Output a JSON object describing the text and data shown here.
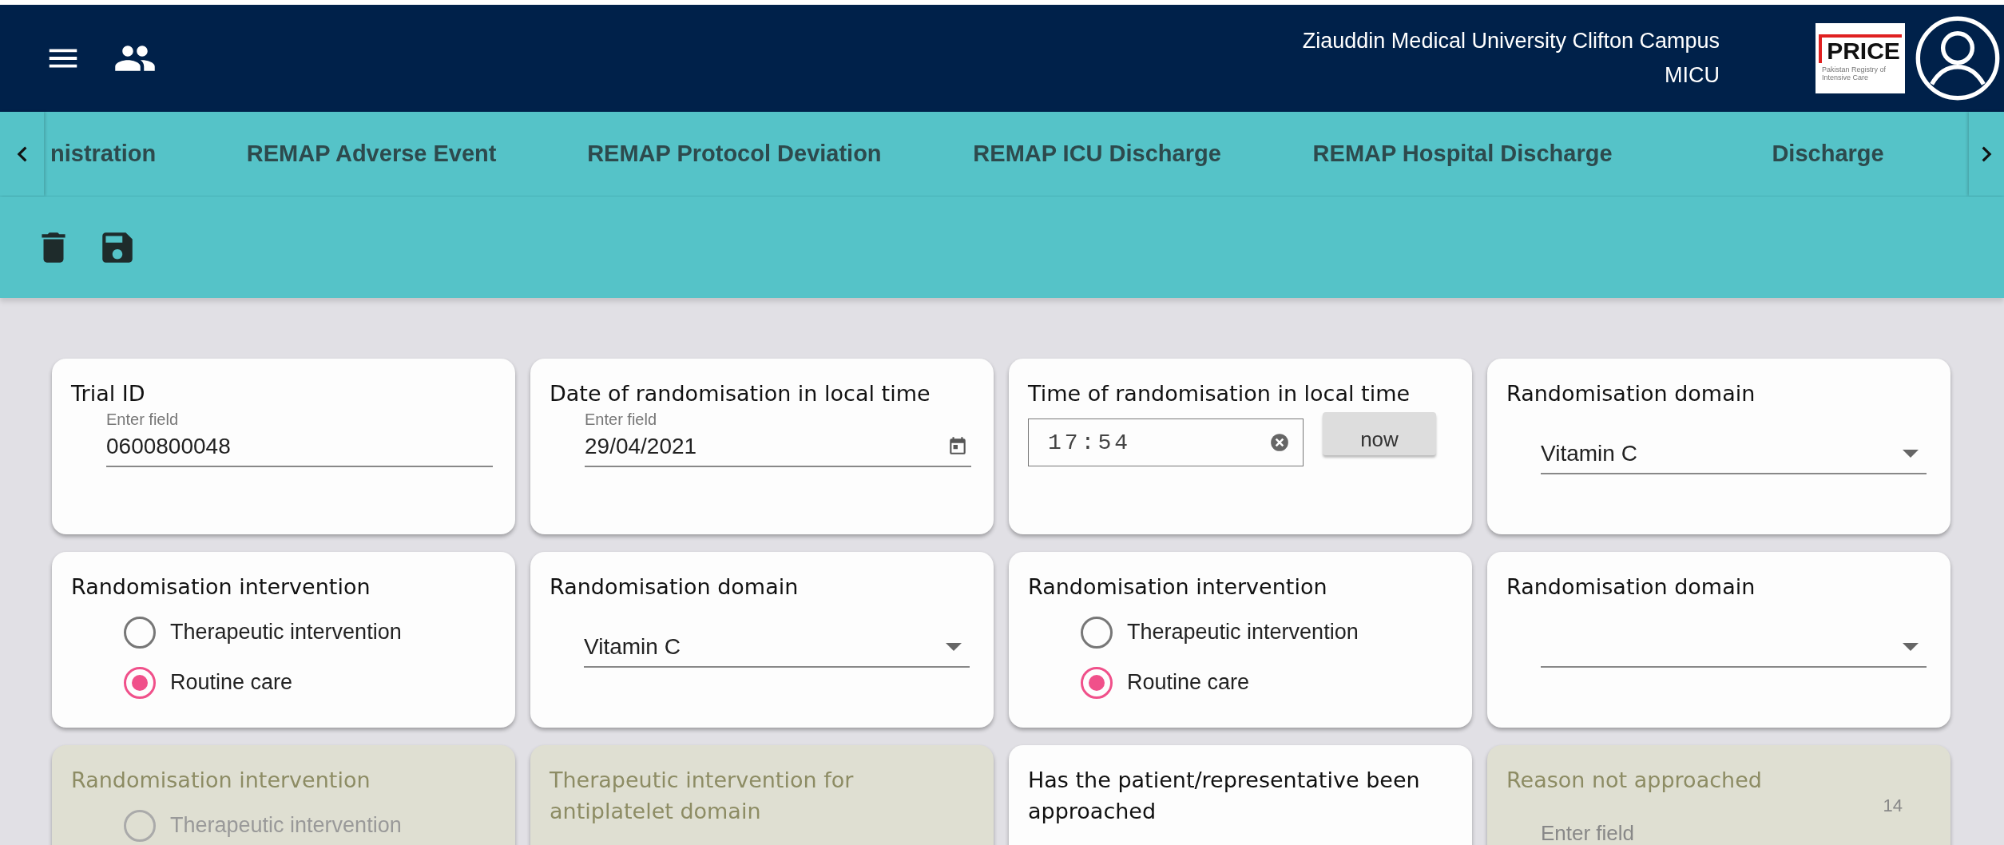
{
  "header": {
    "title": "Ziauddin Medical University Clifton Campus",
    "subtitle": "MICU",
    "logo_text": "PRICE",
    "logo_caption": "Pakistan Registry of Intensive Care"
  },
  "tabs": [
    {
      "label": "nistration",
      "selected": false
    },
    {
      "label": "REMAP Adverse Event",
      "selected": false
    },
    {
      "label": "REMAP Protocol Deviation",
      "selected": false
    },
    {
      "label": "REMAP ICU Discharge",
      "selected": false
    },
    {
      "label": "REMAP Hospital Discharge",
      "selected": false
    },
    {
      "label": "Discharge",
      "selected": false
    }
  ],
  "cards": [
    {
      "kind": "text",
      "label": "Trial ID",
      "disabled": false,
      "field_label": "Enter field",
      "value": "0600800048"
    },
    {
      "kind": "date",
      "label": "Date of randomisation in local time",
      "disabled": false,
      "field_label": "Enter field",
      "value": "29/04/2021"
    },
    {
      "kind": "time",
      "label": "Time of randomisation in local time",
      "disabled": false,
      "value": "17:54",
      "button": "now"
    },
    {
      "kind": "select",
      "label": "Randomisation domain",
      "disabled": false,
      "value": "Vitamin C"
    },
    {
      "kind": "radio",
      "label": "Randomisation intervention",
      "disabled": false,
      "options": [
        {
          "label": "Therapeutic intervention",
          "selected": false
        },
        {
          "label": "Routine care",
          "selected": true
        }
      ]
    },
    {
      "kind": "select",
      "label": "Randomisation domain",
      "disabled": false,
      "value": "Vitamin C"
    },
    {
      "kind": "radio",
      "label": "Randomisation intervention",
      "disabled": false,
      "options": [
        {
          "label": "Therapeutic intervention",
          "selected": false
        },
        {
          "label": "Routine care",
          "selected": true
        }
      ]
    },
    {
      "kind": "select",
      "label": "Randomisation domain",
      "disabled": false
    },
    {
      "kind": "radio",
      "label": "Randomisation intervention",
      "disabled": true,
      "options": [
        {
          "label": "Therapeutic intervention",
          "selected": false
        }
      ]
    },
    {
      "kind": "label",
      "label": "Therapeutic intervention for antiplatelet domain",
      "disabled": true
    },
    {
      "kind": "label",
      "label": "Has the patient/representative been approached",
      "disabled": false
    },
    {
      "kind": "textarea",
      "label": "Reason not approached",
      "disabled": true,
      "counter": "14",
      "field_label": "Enter field"
    }
  ]
}
